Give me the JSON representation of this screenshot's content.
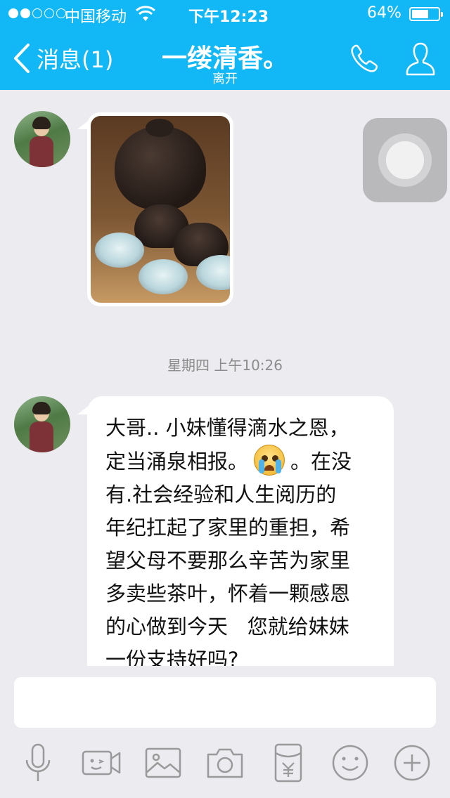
{
  "status_bar": {
    "carrier": "中国移动",
    "time": "下午12:23",
    "battery_percent": "64%",
    "battery_level": 0.64,
    "signal_bars_filled": 2,
    "signal_bars_total": 5
  },
  "nav": {
    "back_label": "消息(1)",
    "title": "一缕清香。",
    "subtitle": "离开",
    "icons": [
      "back-chevron-icon",
      "phone-icon",
      "profile-icon"
    ]
  },
  "conversation": {
    "messages": [
      {
        "type": "image",
        "from": "contact",
        "image_description_icon": "teapot-photo"
      },
      {
        "type": "timestamp",
        "text": "星期四 上午10:26"
      },
      {
        "type": "text",
        "from": "contact",
        "text_before_emoji": "大哥.. 小妹懂得滴水之恩，\n定当涌泉相报。",
        "emoji": "crying-emoji",
        "text_after_emoji": "。在没\n有.社会经验和人生阅历的\n年纪扛起了家里的重担，希\n望父母不要那么辛苦为家里\n多卖些茶叶，怀着一颗感恩\n的心做到今天   您就给妹妹\n一份支持好吗?"
      }
    ]
  },
  "input": {
    "value": "",
    "placeholder": ""
  },
  "toolbar": {
    "items": [
      "microphone-icon",
      "video-call-icon",
      "image-icon",
      "camera-icon",
      "red-packet-icon",
      "emoji-icon",
      "plus-icon"
    ]
  },
  "colors": {
    "accent": "#12b7f5",
    "background": "#ebebf0",
    "bubble": "#ffffff",
    "toolbar_icon": "#9a9a9a"
  }
}
